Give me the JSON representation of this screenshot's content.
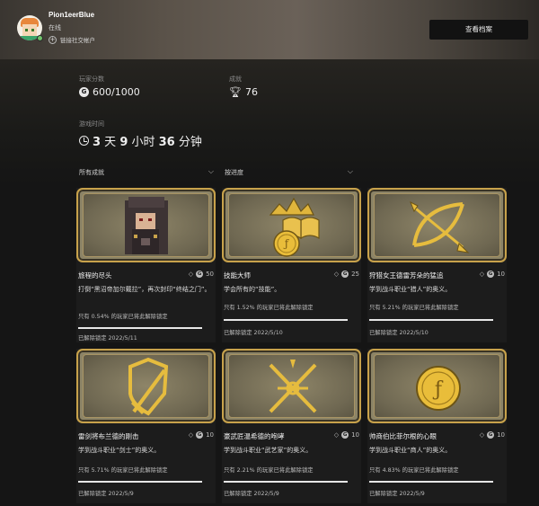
{
  "profile": {
    "gamertag": "Pion1eerBlue",
    "status": "在线",
    "link_social": "链接社交帐户",
    "view_profile": "查看档案"
  },
  "stats": {
    "gamerscore_label": "玩家分数",
    "gamerscore_value": "600/1000",
    "achievements_label": "成就",
    "achievements_value": "76",
    "playtime_label": "游戏时间",
    "playtime": {
      "d": "3",
      "d_unit": " 天 ",
      "h": "9",
      "h_unit": " 小时 ",
      "m": "36",
      "m_unit": " 分钟"
    }
  },
  "filters": {
    "scope": "所有成就",
    "sort": "按进度"
  },
  "cards": [
    {
      "title": "旅程的尽头",
      "score": "50",
      "desc": "打倒“黑沼帝加尔戴拉”，再次封印“终结之门”。",
      "rarity": "只有 0.54% 的玩家已将此解除锁定",
      "unlocked": "已解除锁定 2022/5/11",
      "art_icon": "dark-haired-character-portrait"
    },
    {
      "title": "技能大师",
      "score": "25",
      "desc": "学会所有的“技能”。",
      "rarity": "只有 1.52% 的玩家已将此解除锁定",
      "unlocked": "已解除锁定 2022/5/10",
      "art_icon": "crown-coin-book"
    },
    {
      "title": "狩猎女王德雷芳朵的猛追",
      "score": "10",
      "desc": "学到战斗职业“猎人”的奥义。",
      "rarity": "只有 5.21% 的玩家已将此解除锁定",
      "unlocked": "已解除锁定 2022/5/10",
      "art_icon": "bow-and-arrow"
    },
    {
      "title": "雷剑将布兰德的刚击",
      "score": "10",
      "desc": "学到战斗职业“剑士”的奥义。",
      "rarity": "只有 5.71% 的玩家已将此解除锁定",
      "unlocked": "已解除锁定 2022/5/9",
      "art_icon": "sword-and-shield"
    },
    {
      "title": "豪武匠温希德的咆哮",
      "score": "10",
      "desc": "学到战斗职业“武艺家”的奥义。",
      "rarity": "只有 2.21% 的玩家已将此解除锁定",
      "unlocked": "已解除锁定 2022/5/9",
      "art_icon": "crossed-weapons"
    },
    {
      "title": "帅商伯比菲尔根的心眼",
      "score": "10",
      "desc": "学到战斗职业“商人”的奥义。",
      "rarity": "只有 4.83% 的玩家已将此解除锁定",
      "unlocked": "已解除锁定 2022/5/9",
      "art_icon": "gold-coin"
    }
  ]
}
